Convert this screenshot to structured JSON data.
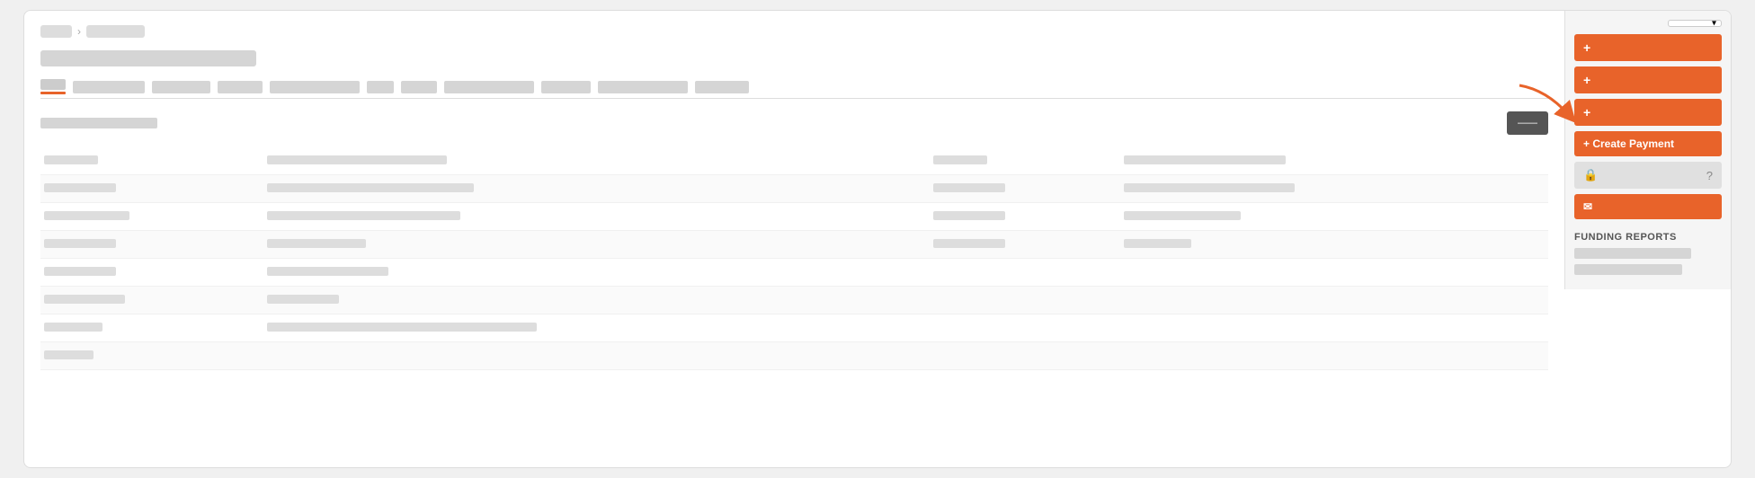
{
  "breadcrumb": {
    "item1_label": "—",
    "sep": ">",
    "item2_label": "———"
  },
  "title": "——————————————",
  "tabs": [
    {
      "label": "—",
      "active": true
    },
    {
      "label": "——————————",
      "active": false
    },
    {
      "label": "————————",
      "active": false
    },
    {
      "label": "——————",
      "active": false
    },
    {
      "label": "——————————————",
      "active": false
    },
    {
      "label": "———",
      "active": false
    },
    {
      "label": "————",
      "active": false
    },
    {
      "label": "——————————————",
      "active": false
    },
    {
      "label": "——————",
      "active": false
    },
    {
      "label": "——————————————",
      "active": false
    }
  ],
  "section_label": "———————————",
  "dark_button_label": "——",
  "table_rows": [
    {
      "col1": "————————",
      "col2": "———————————————————————————",
      "col3": "————————",
      "col4": "——————————————————————————"
    },
    {
      "col1": "——————————",
      "col2": "——————————————————————————————",
      "col3": "——————————",
      "col4": "—————————————————————————"
    },
    {
      "col1": "———————————",
      "col2": "————————————————————————————",
      "col3": "——————————",
      "col4": "—————————————"
    },
    {
      "col1": "——————————",
      "col2": "——————————————",
      "col3": "——————————",
      "col4": "————————"
    },
    {
      "col1": "——————————",
      "col2": "—————————————————",
      "col3": "",
      "col4": ""
    },
    {
      "col1": "———————————",
      "col2": "——————————",
      "col3": "",
      "col4": ""
    },
    {
      "col1": "————————",
      "col2": "————————————————————————————————————————",
      "col3": "",
      "col4": ""
    },
    {
      "col1": "————————",
      "col2": "",
      "col3": "",
      "col4": ""
    }
  ],
  "sidebar": {
    "dropdown_label": "",
    "btn1_label": "+",
    "btn2_label": "+",
    "btn3_label": "+",
    "create_payment_label": "+ Create Payment",
    "lock_btn_label": "",
    "email_btn_label": "✉",
    "funding_reports_title": "FUNDING REPORTS",
    "report_items": [
      "",
      ""
    ]
  },
  "colors": {
    "accent": "#e8632a",
    "bg": "#f5f5f5",
    "text_muted": "#888",
    "dark_btn": "#555"
  }
}
